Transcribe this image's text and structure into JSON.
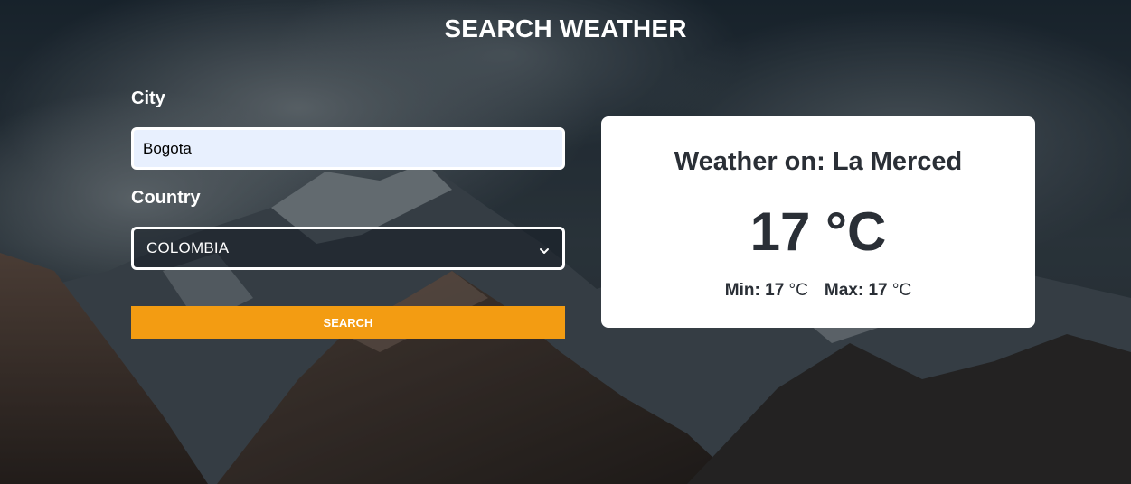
{
  "page": {
    "title": "SEARCH WEATHER"
  },
  "form": {
    "city_label": "City",
    "city_value": "Bogota",
    "country_label": "Country",
    "country_selected": "COLOMBIA",
    "search_button_label": "SEARCH"
  },
  "weather": {
    "heading_prefix": "Weather on: ",
    "location": "La Merced",
    "temperature": "17",
    "temperature_unit": "°C",
    "min_label": "Min:",
    "min_value": "17",
    "max_label": "Max:",
    "max_value": "17",
    "unit": "°C"
  },
  "colors": {
    "accent": "#f39c12",
    "card_bg": "#ffffff",
    "input_bg": "#e8f0fe",
    "text_dark": "#2a2f36"
  },
  "icons": {
    "select_chevron": "chevron-down-icon"
  }
}
